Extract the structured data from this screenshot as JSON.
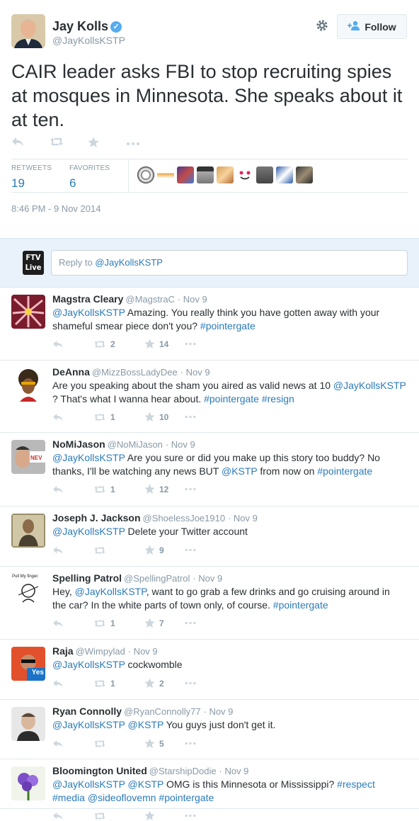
{
  "tweet": {
    "author_name": "Jay Kolls",
    "author_handle": "@JayKollsKSTP",
    "verified_mark": "✓",
    "follow_label": "Follow",
    "text": "CAIR leader asks FBI to stop recruiting spies at mosques in Minnesota. She speaks about it at ten.",
    "retweets_label": "RETWEETS",
    "retweets_count": "19",
    "favorites_label": "FAVORITES",
    "favorites_count": "6",
    "timestamp": "8:46 PM - 9 Nov 2014"
  },
  "composer": {
    "logo_text_1": "FTV",
    "logo_text_2": "Live",
    "placeholder_prefix": "Reply to ",
    "placeholder_handle": "@JayKollsKSTP"
  },
  "icons": [
    "reply-icon",
    "retweet-icon",
    "favorite-icon",
    "more-icon",
    "gear-icon",
    "follow-person-icon",
    "verified-icon"
  ],
  "colors": {
    "link": "#2b7bb9",
    "accent": "#55acee",
    "reply_bg": "#e9f2fb",
    "muted": "#8899a6"
  },
  "replies": [
    {
      "name": "Magstra Cleary",
      "handle": "@MagstraC",
      "date": "· Nov 9",
      "segments": [
        [
          "@JayKollsKSTP",
          true
        ],
        [
          " Amazing. You really think you have gotten away with your shameful smear piece don't you?  ",
          false
        ],
        [
          "#pointergate",
          true
        ]
      ],
      "retweets": "2",
      "favorites": "14"
    },
    {
      "name": "DeAnna",
      "handle": "@MizzBossLadyDee",
      "date": "· Nov 9",
      "segments": [
        [
          "Are you speaking about the sham you aired as valid news at 10 ",
          false
        ],
        [
          "@JayKollsKSTP",
          true
        ],
        [
          " ? That's what I wanna hear about. ",
          false
        ],
        [
          "#pointergate",
          true
        ],
        [
          " ",
          false
        ],
        [
          "#resign",
          true
        ]
      ],
      "retweets": "1",
      "favorites": "10"
    },
    {
      "name": "NoMiJason",
      "handle": "@NoMiJason",
      "date": "· Nov 9",
      "segments": [
        [
          "@JayKollsKSTP",
          true
        ],
        [
          " Are you sure or did you make up this story too buddy? No thanks, I'll be watching any news BUT ",
          false
        ],
        [
          "@KSTP",
          true
        ],
        [
          " from now on ",
          false
        ],
        [
          "#pointergate",
          true
        ]
      ],
      "retweets": "1",
      "favorites": "12"
    },
    {
      "name": "Joseph J. Jackson",
      "handle": "@ShoelessJoe1910",
      "date": "· Nov 9",
      "segments": [
        [
          "@JayKollsKSTP",
          true
        ],
        [
          " Delete your Twitter account",
          false
        ]
      ],
      "retweets": "",
      "favorites": "9"
    },
    {
      "name": "Spelling Patrol",
      "handle": "@SpellingPatrol",
      "date": "· Nov 9",
      "segments": [
        [
          "Hey, ",
          false
        ],
        [
          "@JayKollsKSTP",
          true
        ],
        [
          ", want to go grab a few drinks and go cruising around in the car? In the white parts of town only, of course. ",
          false
        ],
        [
          "#pointergate",
          true
        ]
      ],
      "retweets": "1",
      "favorites": "7",
      "avatar_caption": "Pull My finger."
    },
    {
      "name": "Raja",
      "handle": "@Wimpylad",
      "date": "· Nov 9",
      "segments": [
        [
          "@JayKollsKSTP",
          true
        ],
        [
          " cockwomble",
          false
        ]
      ],
      "retweets": "1",
      "favorites": "2",
      "avatar_caption": "Yes"
    },
    {
      "name": "Ryan Connolly",
      "handle": "@RyanConnolly77",
      "date": "· Nov 9",
      "segments": [
        [
          "@JayKollsKSTP",
          true
        ],
        [
          " ",
          false
        ],
        [
          "@KSTP",
          true
        ],
        [
          " You guys just don't get it.",
          false
        ]
      ],
      "retweets": "",
      "favorites": "5"
    },
    {
      "name": "Bloomington United",
      "handle": "@StarshipDodie",
      "date": "· Nov 9",
      "segments": [
        [
          "@JayKollsKSTP",
          true
        ],
        [
          " ",
          false
        ],
        [
          "@KSTP",
          true
        ],
        [
          " OMG is this Minnesota or Mississippi? ",
          false
        ],
        [
          "#respect",
          true
        ],
        [
          " ",
          false
        ],
        [
          "#media",
          true
        ],
        [
          " ",
          false
        ],
        [
          "@sideoflovemn",
          true
        ],
        [
          " ",
          false
        ],
        [
          "#pointergate",
          true
        ]
      ],
      "retweets": "",
      "favorites": ""
    }
  ]
}
